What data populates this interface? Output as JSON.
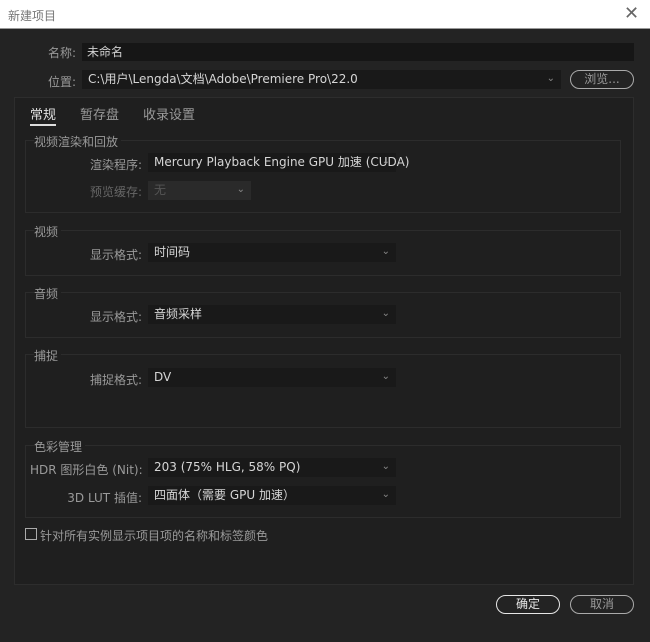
{
  "window": {
    "title": "新建项目"
  },
  "name": {
    "label": "名称:",
    "value": "未命名"
  },
  "location": {
    "label": "位置:",
    "value": "C:\\用户\\Lengda\\文档\\Adobe\\Premiere Pro\\22.0",
    "browse": "浏览..."
  },
  "tabs": [
    {
      "label": "常规"
    },
    {
      "label": "暂存盘"
    },
    {
      "label": "收录设置"
    }
  ],
  "groups": {
    "render": {
      "title": "视频渲染和回放",
      "renderer_label": "渲染程序:",
      "renderer_value": "Mercury Playback Engine GPU 加速 (CUDA)",
      "preview_label": "预览缓存:",
      "preview_value": "无"
    },
    "video": {
      "title": "视频",
      "format_label": "显示格式:",
      "format_value": "时间码"
    },
    "audio": {
      "title": "音频",
      "format_label": "显示格式:",
      "format_value": "音频采样"
    },
    "capture": {
      "title": "捕捉",
      "format_label": "捕捉格式:",
      "format_value": "DV"
    },
    "color": {
      "title": "色彩管理",
      "hdr_label": "HDR 图形白色 (Nit):",
      "hdr_value": "203 (75% HLG, 58% PQ)",
      "lut_label": "3D LUT 插值:",
      "lut_value": "四面体（需要 GPU 加速）"
    }
  },
  "checkbox": {
    "label": "针对所有实例显示项目项的名称和标签颜色",
    "checked": false
  },
  "buttons": {
    "ok": "确定",
    "cancel": "取消"
  }
}
